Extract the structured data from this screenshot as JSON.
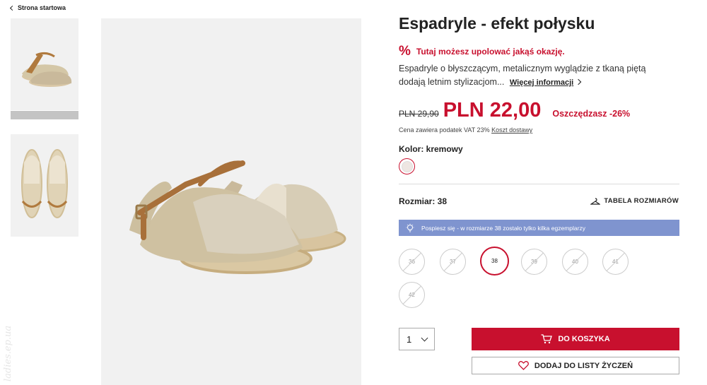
{
  "breadcrumb": {
    "back_label": "Strona startowa"
  },
  "product": {
    "title": "Espadryle - efekt połysku",
    "deal_icon": "%",
    "deal_text": "Tutaj możesz upolować jakąś okazję.",
    "description": "Espadryle o błyszczącym, metalicznym wyglądzie z tkaną piętą dodają letnim stylizacjom...",
    "more_info": "Więcej informacji",
    "old_price": "PLN 29,90",
    "new_price": "PLN 22,00",
    "savings": "Oszczędzasz -26%",
    "vat_text": "Cena zawiera podatek VAT 23%",
    "shipping_link": "Koszt dostawy",
    "color_label": "Kolor: kremowy",
    "size_label": "Rozmiar: 38",
    "size_table": "TABELA ROZMIARÓW",
    "stock_notice": "Pospiesz się - w rozmiarze 38 zostało tylko kilka egzemplarzy",
    "sizes": [
      "36",
      "37",
      "38",
      "39",
      "40",
      "41",
      "42"
    ],
    "selected_size": "38",
    "quantity": "1",
    "add_to_cart": "DO KOSZYKA",
    "add_to_wishlist": "DODAJ DO LISTY ŻYCZEŃ"
  },
  "watermark": "ladies.ep.ua",
  "colors": {
    "accent": "#c8102e",
    "notice": "#7f94cf"
  }
}
